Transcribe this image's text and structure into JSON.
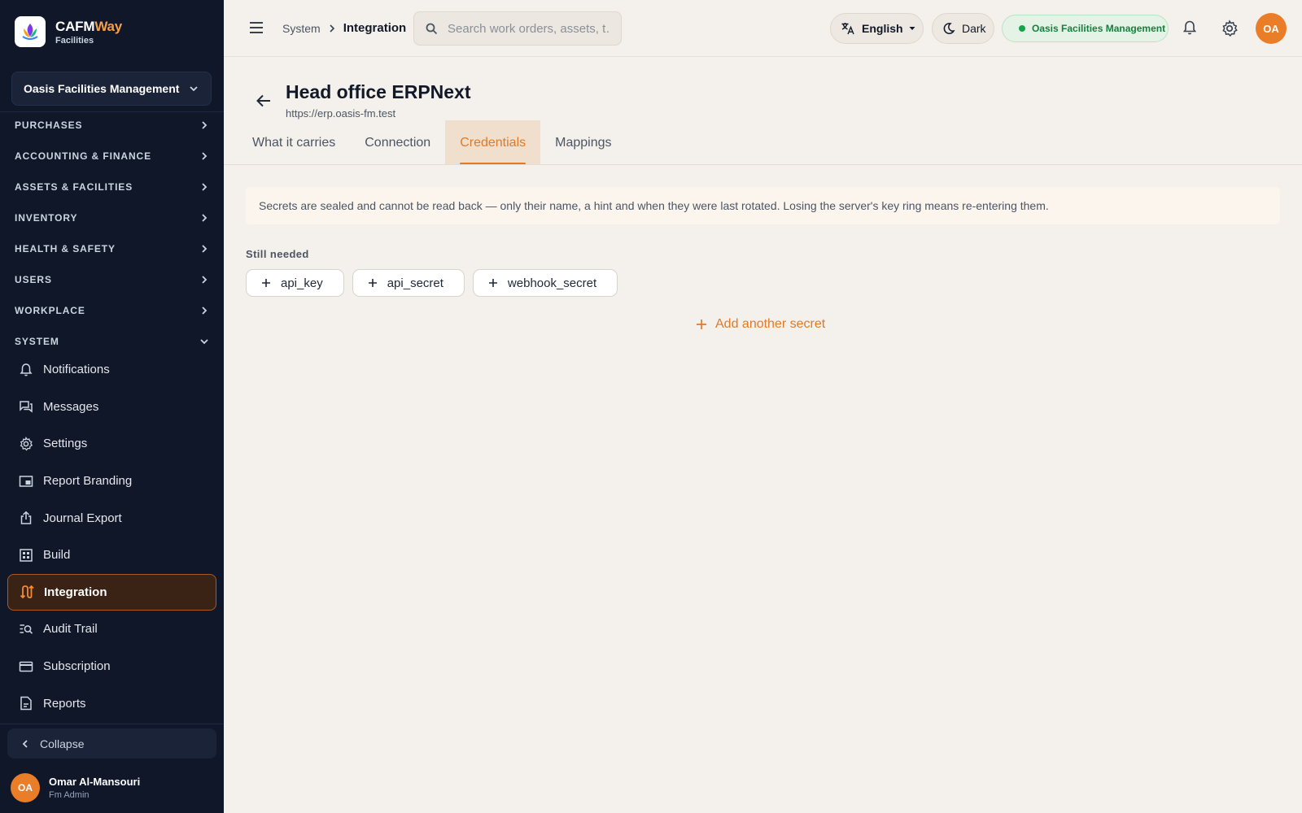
{
  "brand": {
    "name_part1": "CAFM",
    "name_part2": "Way",
    "subtitle": "Facilities"
  },
  "org_selector": {
    "label": "Oasis Facilities Management"
  },
  "sidebar": {
    "sections": [
      {
        "label": "PURCHASES",
        "icon": "chevron-right-icon"
      },
      {
        "label": "ACCOUNTING & FINANCE",
        "icon": "chevron-right-icon"
      },
      {
        "label": "ASSETS & FACILITIES",
        "icon": "chevron-right-icon"
      },
      {
        "label": "INVENTORY",
        "icon": "chevron-right-icon"
      },
      {
        "label": "HEALTH & SAFETY",
        "icon": "chevron-right-icon"
      },
      {
        "label": "USERS",
        "icon": "chevron-right-icon"
      },
      {
        "label": "WORKPLACE",
        "icon": "chevron-right-icon"
      },
      {
        "label": "SYSTEM",
        "icon": "chevron-down-icon"
      }
    ],
    "system_items": [
      {
        "label": "Notifications",
        "icon": "bell-icon"
      },
      {
        "label": "Messages",
        "icon": "chat-icon"
      },
      {
        "label": "Settings",
        "icon": "gear-icon"
      },
      {
        "label": "Report Branding",
        "icon": "branding-icon"
      },
      {
        "label": "Journal Export",
        "icon": "export-icon"
      },
      {
        "label": "Build",
        "icon": "build-icon"
      },
      {
        "label": "Integration",
        "icon": "integration-icon",
        "active": true
      },
      {
        "label": "Audit Trail",
        "icon": "audit-icon"
      },
      {
        "label": "Subscription",
        "icon": "card-icon"
      },
      {
        "label": "Reports",
        "icon": "report-icon"
      }
    ],
    "collapse_label": "Collapse",
    "user": {
      "initials": "OA",
      "name": "Omar Al-Mansouri",
      "role": "Fm Admin"
    }
  },
  "topbar": {
    "breadcrumb": [
      "System",
      "Integration"
    ],
    "search_placeholder": "Search work orders, assets, t…",
    "language": "English",
    "theme": "Dark",
    "org_badge": "Oasis Facilities Management",
    "avatar_initials": "OA"
  },
  "page": {
    "title": "Head office ERPNext",
    "url": "https://erp.oasis-fm.test",
    "tabs": [
      {
        "label": "What it carries"
      },
      {
        "label": "Connection"
      },
      {
        "label": "Credentials",
        "active": true
      },
      {
        "label": "Mappings"
      }
    ],
    "notice": "Secrets are sealed and cannot be read back — only their name, a hint and when they were last rotated. Losing the server's key ring means re-entering them.",
    "still_needed_label": "Still needed",
    "needed_secrets": [
      "api_key",
      "api_secret",
      "webhook_secret"
    ],
    "add_secret_label": "Add another secret"
  },
  "colors": {
    "accent": "#e07a27",
    "sidebar_bg": "#0f1729",
    "page_bg": "#f4f1ec",
    "status_green": "#16a34a"
  }
}
